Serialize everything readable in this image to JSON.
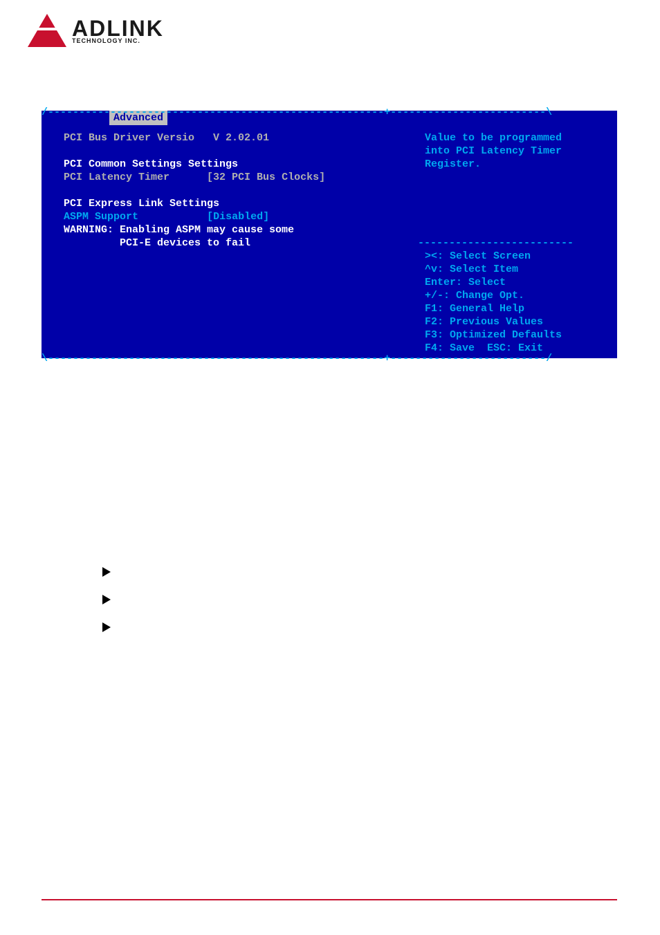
{
  "logo": {
    "brand": "ADLINK",
    "sub": "TECHNOLOGY INC."
  },
  "bios": {
    "tab": "Advanced",
    "left": {
      "line1_label": "PCI Bus Driver Versio",
      "line1_value": "V 2.02.01",
      "section1_title": "PCI Common Settings Settings",
      "latency_label": "PCI Latency Timer",
      "latency_value": "[32 PCI Bus Clocks]",
      "section2_title": "PCI Express Link Settings",
      "aspm_label": "ASPM Support",
      "aspm_value": "[Disabled]",
      "warning1": "WARNING: Enabling ASPM may cause some",
      "warning2": "         PCI-E devices to fail"
    },
    "right": {
      "help1": "Value to be programmed",
      "help2": "into PCI Latency Timer",
      "help3": "Register.",
      "nav1": "><: Select Screen",
      "nav2": "^v: Select Item",
      "nav3": "Enter: Select",
      "nav4": "+/-: Change Opt.",
      "nav5": "F1: General Help",
      "nav6": "F2: Previous Values",
      "nav7": "F3: Optimized Defaults",
      "nav8": "F4: Save  ESC: Exit"
    }
  }
}
